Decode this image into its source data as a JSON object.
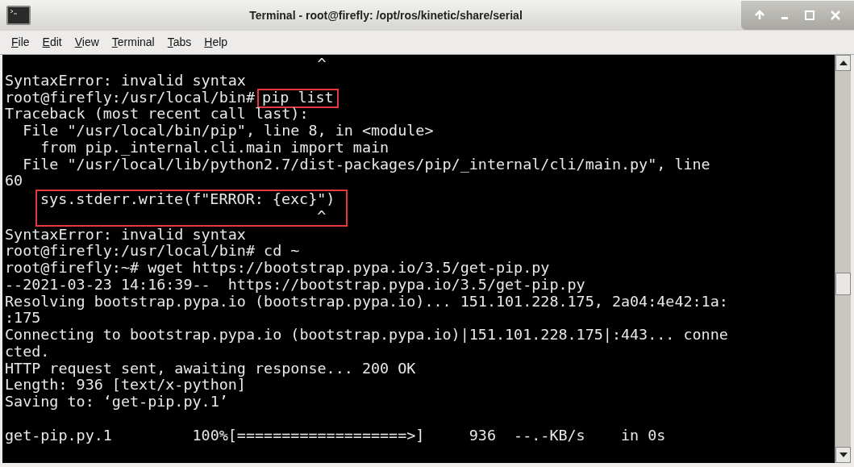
{
  "window": {
    "title": "Terminal - root@firefly: /opt/ros/kinetic/share/serial"
  },
  "menu": [
    "File",
    "Edit",
    "View",
    "Terminal",
    "Tabs",
    "Help"
  ],
  "terminal": [
    {
      "kind": "line",
      "text": "                                   ^"
    },
    {
      "kind": "line",
      "text": "SyntaxError: invalid syntax"
    },
    {
      "kind": "prompt",
      "prompt": "root@firefly:/usr/local/bin# ",
      "command": "pip list",
      "boxed": true
    },
    {
      "kind": "line",
      "text": "Traceback (most recent call last):"
    },
    {
      "kind": "line",
      "text": "  File \"/usr/local/bin/pip\", line 8, in <module>"
    },
    {
      "kind": "line",
      "text": "    from pip._internal.cli.main import main"
    },
    {
      "kind": "line",
      "text": "  File \"/usr/local/lib/python2.7/dist-packages/pip/_internal/cli/main.py\", line"
    },
    {
      "kind": "line",
      "text": "60"
    },
    {
      "kind": "boxed_block",
      "lines": [
        "sys.stderr.write(f\"ERROR: {exc}\")",
        "                               ^"
      ]
    },
    {
      "kind": "line",
      "text": "SyntaxError: invalid syntax"
    },
    {
      "kind": "line",
      "text": "root@firefly:/usr/local/bin# cd ~"
    },
    {
      "kind": "line",
      "text": "root@firefly:~# wget https://bootstrap.pypa.io/3.5/get-pip.py"
    },
    {
      "kind": "line",
      "text": "--2021-03-23 14:16:39--  https://bootstrap.pypa.io/3.5/get-pip.py"
    },
    {
      "kind": "line",
      "text": "Resolving bootstrap.pypa.io (bootstrap.pypa.io)... 151.101.228.175, 2a04:4e42:1a:"
    },
    {
      "kind": "line",
      "text": ":175"
    },
    {
      "kind": "line",
      "text": "Connecting to bootstrap.pypa.io (bootstrap.pypa.io)|151.101.228.175|:443... conne"
    },
    {
      "kind": "line",
      "text": "cted."
    },
    {
      "kind": "line",
      "text": "HTTP request sent, awaiting response... 200 OK"
    },
    {
      "kind": "line",
      "text": "Length: 936 [text/x-python]"
    },
    {
      "kind": "line",
      "text": "Saving to: ‘get-pip.py.1’"
    },
    {
      "kind": "blank"
    },
    {
      "kind": "line",
      "text": "get-pip.py.1         100%[===================>]     936  --.-KB/s    in 0s"
    }
  ]
}
